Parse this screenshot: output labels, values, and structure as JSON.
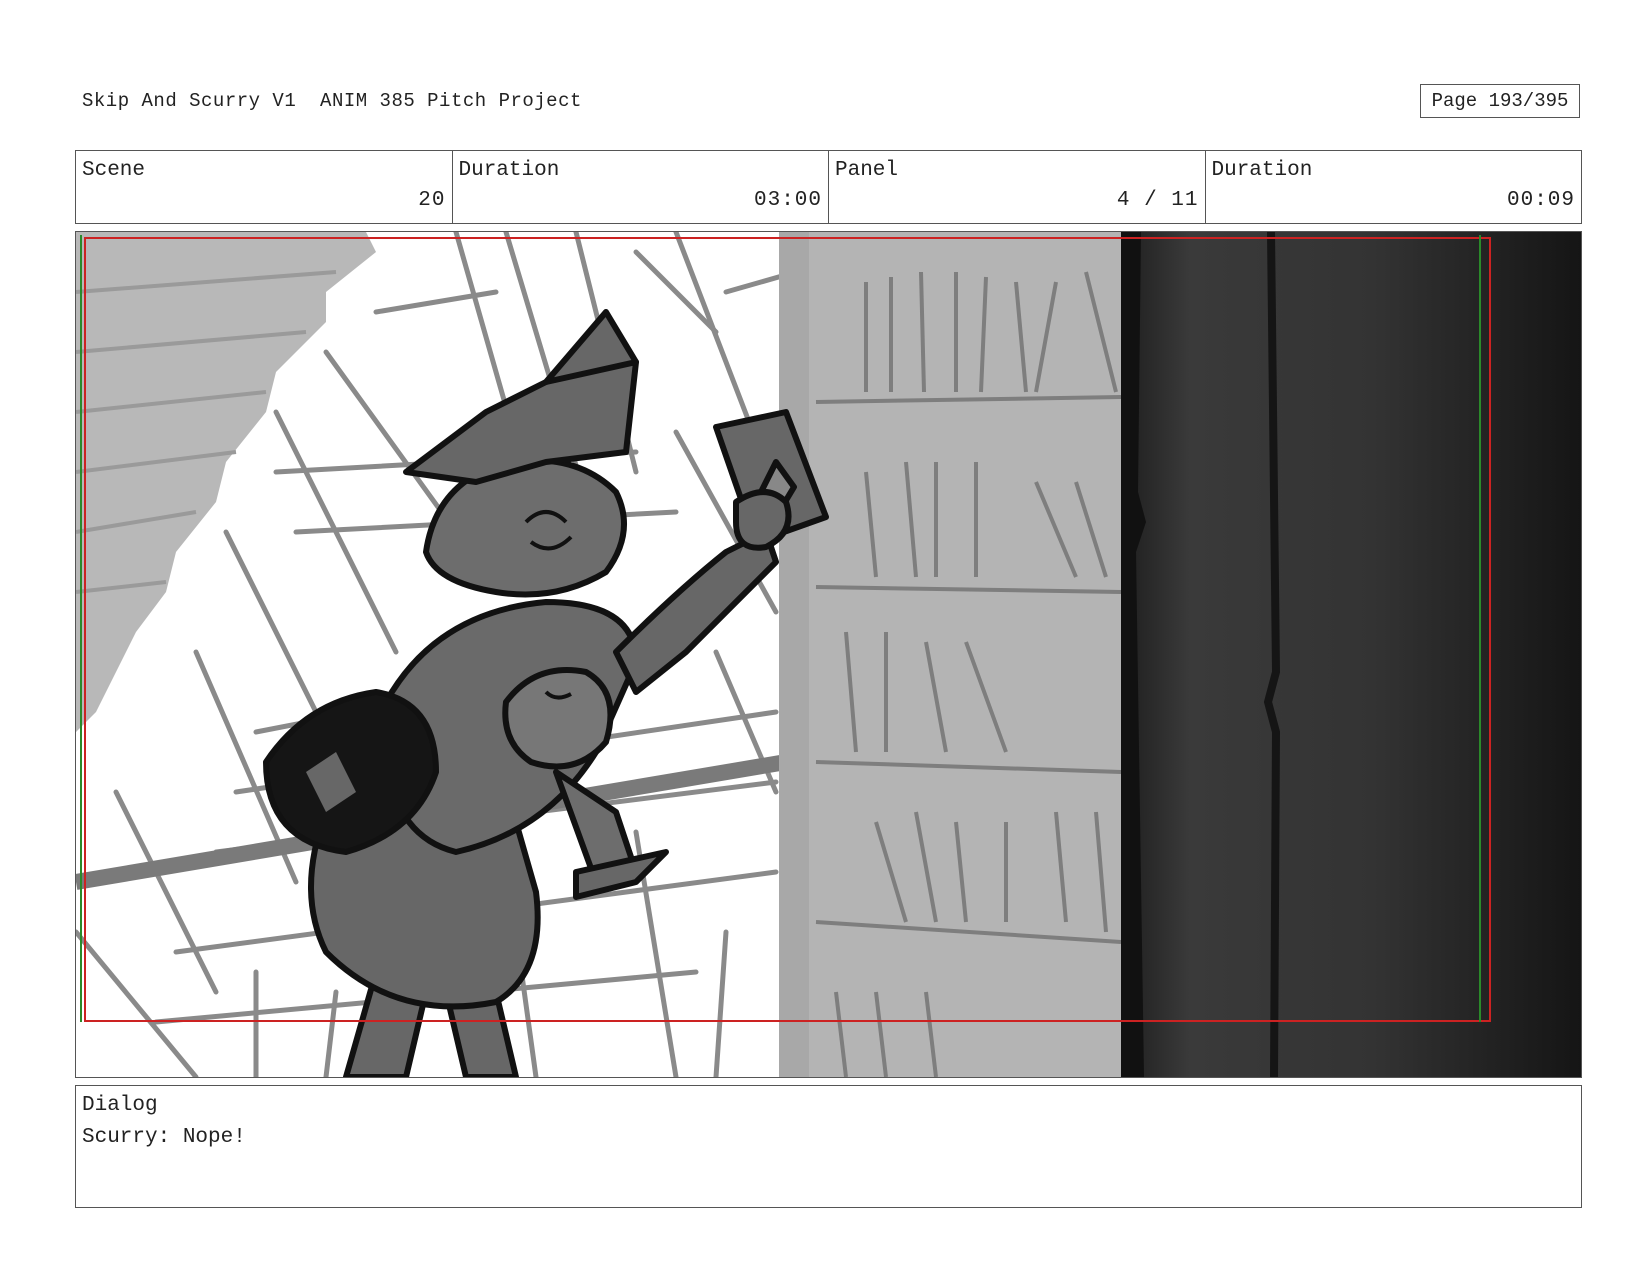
{
  "header": {
    "project_title": "Skip And Scurry V1  ANIM 385 Pitch Project",
    "page_label": "Page 193/395"
  },
  "info": {
    "scene_label": "Scene",
    "scene_value": "20",
    "duration_label": "Duration",
    "duration_value": "03:00",
    "panel_label": "Panel",
    "panel_value": "4 / 11",
    "panel_duration_label": "Duration",
    "panel_duration_value": "00:09"
  },
  "panel_image": {
    "icon": "storyboard-sketch-witch-reaching-book",
    "colors": {
      "bookshelf": "#b4b4b4",
      "dark_area": "#262626",
      "character": "#676767",
      "safe_frame": "#cc2222",
      "line": "#111111"
    }
  },
  "dialog": {
    "label": "Dialog",
    "text": "Scurry: Nope!"
  }
}
